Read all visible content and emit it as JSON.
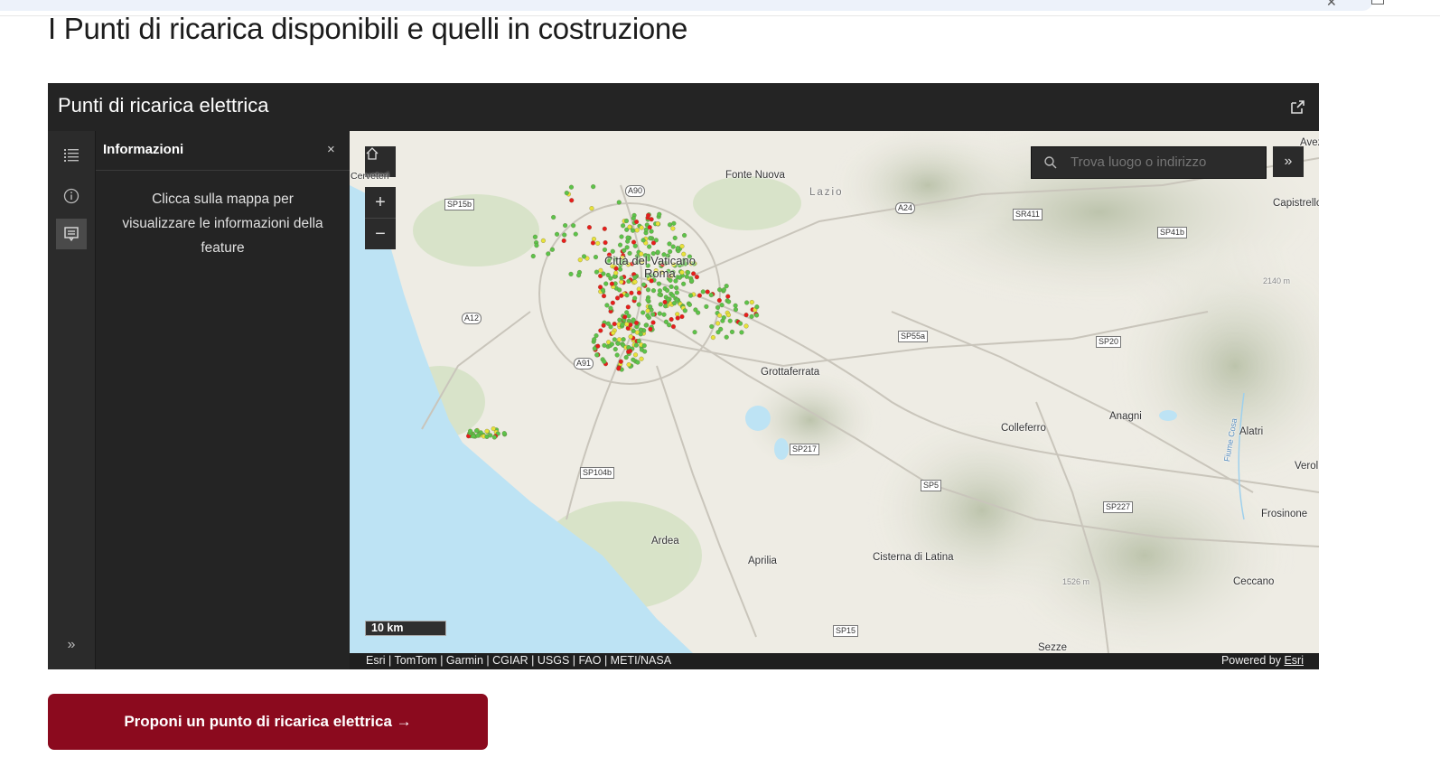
{
  "page": {
    "title": "I Punti di ricarica disponibili e quelli in costruzione",
    "cta_label": "Proponi un punto di ricarica elettrica →"
  },
  "app": {
    "title": "Punti di ricarica elettrica",
    "panel": {
      "title": "Informazioni",
      "close_label": "×",
      "body": "Clicca sulla mappa per visualizzare le informazioni della feature"
    },
    "search_placeholder": "Trova luogo o indirizzo",
    "scale_label": "10 km",
    "attribution": "Esri | TomTom | Garmin | CGIAR | USGS | FAO | METI/NASA",
    "powered_by": "Powered by",
    "powered_link": "Esri"
  },
  "map": {
    "places": [
      {
        "id": "cerveteri",
        "label": "Cerveteri"
      },
      {
        "id": "fonte-nuova",
        "label": "Fonte Nuova"
      },
      {
        "id": "lazio",
        "label": "Lazio"
      },
      {
        "id": "capistrello",
        "label": "Capistrello"
      },
      {
        "id": "avezzano",
        "label": "Avez"
      },
      {
        "id": "vaticano",
        "label": "Città del Vaticano"
      },
      {
        "id": "roma",
        "label": "Roma"
      },
      {
        "id": "grottaferrata",
        "label": "Grottaferrata"
      },
      {
        "id": "colleferro",
        "label": "Colleferro"
      },
      {
        "id": "anagni",
        "label": "Anagni"
      },
      {
        "id": "alatri",
        "label": "Alatri"
      },
      {
        "id": "veroli",
        "label": "Veroli"
      },
      {
        "id": "frosinone",
        "label": "Frosinone"
      },
      {
        "id": "ceccano",
        "label": "Ceccano"
      },
      {
        "id": "ardea",
        "label": "Ardea"
      },
      {
        "id": "aprilia",
        "label": "Aprilia"
      },
      {
        "id": "cisterna",
        "label": "Cisterna di Latina"
      },
      {
        "id": "sezze",
        "label": "Sezze"
      },
      {
        "id": "elev-2140",
        "label": "2140 m"
      },
      {
        "id": "elev-1526",
        "label": "1526 m"
      },
      {
        "id": "fiume-cosa",
        "label": "Fiume Cosa"
      }
    ],
    "roads": [
      "SP15b",
      "A90",
      "A24",
      "SR411",
      "SP41b",
      "A12",
      "SP55a",
      "SP20",
      "A91",
      "SP217",
      "SP104b",
      "SP5",
      "SP227",
      "SP15"
    ]
  },
  "colors": {
    "brand": "#8b0a1e",
    "available_point": "#5cc34a",
    "construction_point": "#e81d1d",
    "planned_point": "#e8e23a",
    "sea": "#bde3f4"
  }
}
